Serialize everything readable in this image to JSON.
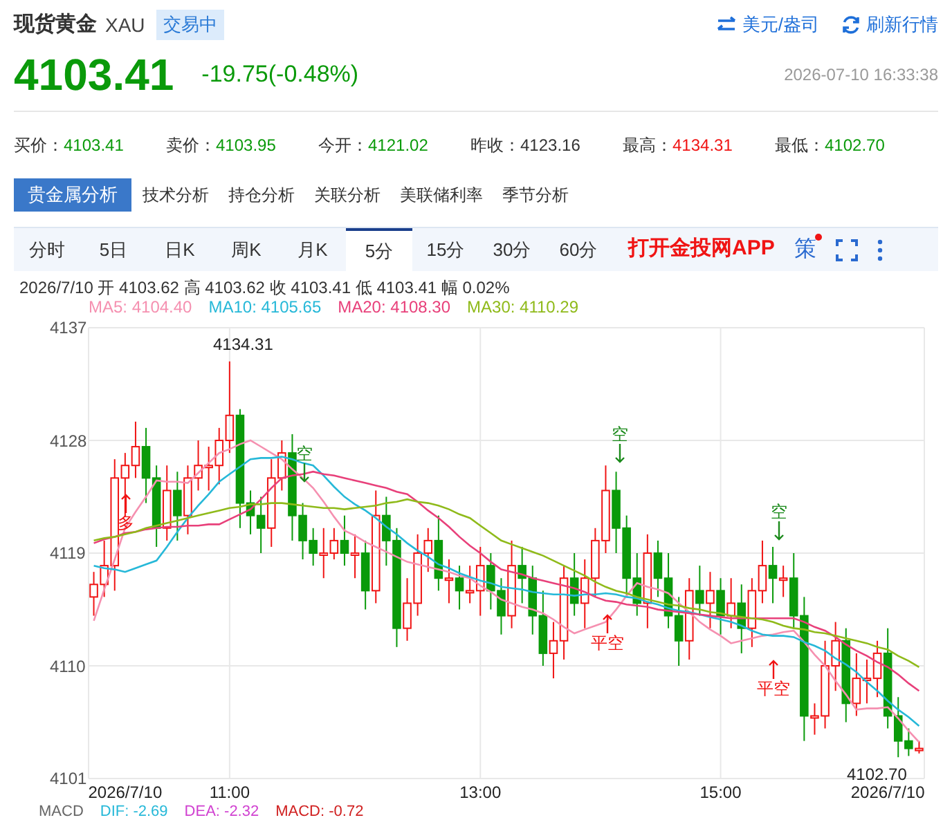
{
  "header": {
    "title": "现货黄金",
    "symbol": "XAU",
    "status": "交易中",
    "unit_link": "美元/盎司",
    "refresh_link": "刷新行情"
  },
  "quote": {
    "price": "4103.41",
    "change": "-19.75(-0.48%)",
    "time": "2026-07-10 16:33:38"
  },
  "stats": [
    {
      "label": "买价：",
      "value": "4103.41",
      "color": "#0a9a0a"
    },
    {
      "label": "卖价：",
      "value": "4103.95",
      "color": "#0a9a0a"
    },
    {
      "label": "今开：",
      "value": "4121.02",
      "color": "#0a9a0a"
    },
    {
      "label": "昨收：",
      "value": "4123.16",
      "color": "#333333"
    },
    {
      "label": "最高：",
      "value": "4134.31",
      "color": "#f01414"
    },
    {
      "label": "最低：",
      "value": "4102.70",
      "color": "#0a9a0a"
    }
  ],
  "analysis_tabs": [
    {
      "label": "贵金属分析",
      "selected": true
    },
    {
      "label": "技术分析",
      "selected": false
    },
    {
      "label": "持仓分析",
      "selected": false
    },
    {
      "label": "关联分析",
      "selected": false
    },
    {
      "label": "美联储利率",
      "selected": false
    },
    {
      "label": "季节分析",
      "selected": false
    }
  ],
  "periods": [
    {
      "label": "分时",
      "selected": false
    },
    {
      "label": "5日",
      "selected": false
    },
    {
      "label": "日K",
      "selected": false
    },
    {
      "label": "周K",
      "selected": false
    },
    {
      "label": "月K",
      "selected": false
    },
    {
      "label": "5分",
      "selected": true
    },
    {
      "label": "15分",
      "selected": false
    },
    {
      "label": "30分",
      "selected": false
    },
    {
      "label": "60分",
      "selected": false
    }
  ],
  "app_link": "打开金投网APP",
  "strategy": "策",
  "bar_info": "2026/7/10 开 4103.62 高 4103.62 收 4103.41 低 4103.41 幅 0.02%",
  "chart": {
    "chart_data": {
      "type": "candlestick",
      "grid": true,
      "ylim": [
        4101,
        4137
      ],
      "yticks": [
        4137,
        4128,
        4119,
        4110,
        4101
      ],
      "categories": [
        null,
        null,
        null,
        "2026/7/10",
        null,
        null,
        null,
        null,
        null,
        null,
        null,
        null,
        null,
        "11:00",
        null,
        null,
        null,
        null,
        null,
        null,
        null,
        null,
        null,
        null,
        null,
        null,
        null,
        null,
        null,
        null,
        null,
        null,
        null,
        null,
        null,
        null,
        null,
        "13:00",
        null,
        null,
        null,
        null,
        null,
        null,
        null,
        null,
        null,
        null,
        null,
        null,
        null,
        null,
        null,
        null,
        null,
        null,
        null,
        null,
        null,
        null,
        "15:00",
        null,
        null,
        null,
        null,
        null,
        null,
        null,
        null,
        null,
        null,
        null,
        null,
        null,
        null,
        null,
        "2026/7/10",
        null,
        null,
        null
      ],
      "ohlc": [
        [
          4115.5,
          4117.5,
          4114,
          4116.5
        ],
        [
          4116.5,
          4120,
          4115.5,
          4118
        ],
        [
          4118,
          4126.5,
          4116,
          4125
        ],
        [
          4125,
          4127,
          4122,
          4126
        ],
        [
          4126,
          4129.5,
          4125,
          4127.5
        ],
        [
          4127.5,
          4129,
          4123,
          4125
        ],
        [
          4125,
          4126,
          4119.5,
          4121
        ],
        [
          4121,
          4126,
          4120,
          4124
        ],
        [
          4124,
          4125.5,
          4120,
          4122
        ],
        [
          4122,
          4126,
          4120.5,
          4125
        ],
        [
          4125,
          4128,
          4124,
          4126
        ],
        [
          4126,
          4127.5,
          4124,
          4126
        ],
        [
          4126,
          4129,
          4124.5,
          4128
        ],
        [
          4128,
          4134.31,
          4127,
          4130
        ],
        [
          4130,
          4130.5,
          4121,
          4123
        ],
        [
          4123,
          4124,
          4120.5,
          4122
        ],
        [
          4122,
          4123.5,
          4119,
          4121
        ],
        [
          4121,
          4126.5,
          4119.5,
          4125
        ],
        [
          4125,
          4128,
          4124,
          4127
        ],
        [
          4127,
          4128.5,
          4120,
          4122
        ],
        [
          4122,
          4123,
          4118.5,
          4120
        ],
        [
          4120,
          4121,
          4118,
          4119
        ],
        [
          4119,
          4121,
          4117,
          4119
        ],
        [
          4119,
          4121,
          4118.5,
          4120
        ],
        [
          4120,
          4122,
          4118,
          4119
        ],
        [
          4119,
          4120.5,
          4117,
          4119
        ],
        [
          4119,
          4120,
          4114.5,
          4116
        ],
        [
          4116,
          4124,
          4115,
          4122
        ],
        [
          4122,
          4123.5,
          4118,
          4120
        ],
        [
          4120,
          4121,
          4111.5,
          4113
        ],
        [
          4113,
          4117,
          4112,
          4115
        ],
        [
          4115,
          4120.5,
          4114,
          4119
        ],
        [
          4119,
          4121,
          4117.5,
          4120
        ],
        [
          4120,
          4122,
          4116,
          4117
        ],
        [
          4117,
          4118.5,
          4115,
          4117
        ],
        [
          4117,
          4118,
          4114.5,
          4116
        ],
        [
          4116,
          4118,
          4115,
          4116
        ],
        [
          4116,
          4119.5,
          4114,
          4118
        ],
        [
          4118,
          4119,
          4114.5,
          4116
        ],
        [
          4116,
          4117,
          4112.5,
          4114
        ],
        [
          4114,
          4120,
          4113,
          4118
        ],
        [
          4118,
          4119.5,
          4115,
          4117
        ],
        [
          4117,
          4118,
          4112.5,
          4114
        ],
        [
          4114,
          4116,
          4110,
          4111
        ],
        [
          4111,
          4113.5,
          4109,
          4112
        ],
        [
          4112,
          4118,
          4110.5,
          4117
        ],
        [
          4117,
          4119,
          4114,
          4115
        ],
        [
          4115,
          4118.5,
          4113,
          4117
        ],
        [
          4117,
          4121,
          4115.5,
          4120
        ],
        [
          4120,
          4126,
          4119,
          4124
        ],
        [
          4124,
          4125.5,
          4119,
          4121
        ],
        [
          4121,
          4122,
          4115.5,
          4117
        ],
        [
          4117,
          4119,
          4114,
          4115
        ],
        [
          4115,
          4120.5,
          4113,
          4119
        ],
        [
          4119,
          4120,
          4115.5,
          4117
        ],
        [
          4117,
          4119,
          4113,
          4114
        ],
        [
          4114,
          4115.5,
          4110,
          4112
        ],
        [
          4112,
          4117,
          4110.5,
          4116
        ],
        [
          4116,
          4118,
          4114,
          4115
        ],
        [
          4115,
          4117.5,
          4113,
          4116
        ],
        [
          4116,
          4117,
          4112.5,
          4114
        ],
        [
          4114,
          4117,
          4113,
          4115
        ],
        [
          4115,
          4116.5,
          4111,
          4113
        ],
        [
          4113,
          4117,
          4111.5,
          4116
        ],
        [
          4116,
          4120,
          4115,
          4118
        ],
        [
          4118,
          4119.5,
          4115,
          4117
        ],
        [
          4117,
          4118,
          4115.5,
          4117
        ],
        [
          4117,
          4119,
          4113,
          4114
        ],
        [
          4114,
          4115.5,
          4104,
          4106
        ],
        [
          4106,
          4107,
          4104.5,
          4106
        ],
        [
          4106,
          4112,
          4105,
          4110
        ],
        [
          4110,
          4113.5,
          4108,
          4112
        ],
        [
          4112,
          4113,
          4105.5,
          4107
        ],
        [
          4107,
          4111,
          4106,
          4109
        ],
        [
          4109,
          4110.5,
          4107,
          4109
        ],
        [
          4109,
          4112,
          4107.5,
          4111
        ],
        [
          4111,
          4113,
          4105,
          4106
        ],
        [
          4106,
          4107.5,
          4102.7,
          4104
        ],
        [
          4104,
          4105,
          4102.8,
          4103.4
        ],
        [
          4103.4,
          4104,
          4103,
          4103.4
        ]
      ]
    },
    "ma_overlay": {
      "chart_data": {
        "type": "line",
        "ylim": [
          4101,
          4137
        ],
        "categories": [
          null,
          null,
          null,
          null,
          null,
          null,
          null,
          null,
          null,
          null,
          null,
          null,
          null,
          null,
          null,
          null,
          null,
          null,
          null,
          null,
          null,
          null,
          null,
          null,
          null,
          null,
          null,
          null,
          null,
          null,
          null,
          null,
          null,
          null,
          null,
          null,
          null,
          null,
          null,
          null,
          null,
          null,
          null,
          null,
          null,
          null,
          null,
          null,
          null,
          null,
          null,
          null,
          null,
          null,
          null,
          null,
          null,
          null,
          null,
          null,
          null,
          null,
          null,
          null,
          null,
          null,
          null,
          null,
          null,
          null,
          null,
          null,
          null,
          null,
          null,
          null,
          null,
          null,
          null,
          null
        ],
        "series": [
          {
            "name": "MA5: 4104.40",
            "color": "#f590b0",
            "values": [
              4113.6,
              4116.1,
              4118.5,
              4121,
              4122.3,
              4123.5,
              4124.8,
              4124.7,
              4124.7,
              4124.6,
              4125.4,
              4126.2,
              4127,
              4127.3,
              4127.7,
              4128,
              4127.5,
              4127,
              4126.5,
              4125.7,
              4125,
              4124.2,
              4123.1,
              4121.9,
              4120.8,
              4120.4,
              4119.9,
              4119.5,
              4119.1,
              4118.7,
              4118.3,
              4118.1,
              4117.9,
              4117.7,
              4117.5,
              4117.2,
              4117,
              4116.4,
              4115.9,
              4115.3,
              4115,
              4114.7,
              4114.5,
              4114.2,
              4113.7,
              4113.1,
              4112.6,
              4112.9,
              4113.2,
              4113.5,
              4114.5,
              4115.6,
              4116.6,
              4116.3,
              4116.1,
              4115.8,
              4115,
              4114.3,
              4113.5,
              4112.9,
              4112.4,
              4111.8,
              4112,
              4112.2,
              4112.4,
              4112.5,
              4112.7,
              4112.8,
              4111.9,
              4110.9,
              4110,
              4108.8,
              4107.7,
              4106.5,
              4106.6,
              4106.6,
              4106.7,
              4105.8,
              4104.8,
              4103.9
            ]
          },
          {
            "name": "MA10: 4105.65",
            "color": "#26b8d8",
            "values": [
              4118,
              4117.8,
              4117.7,
              4117.5,
              4117.8,
              4118.1,
              4118.4,
              4119.5,
              4120.7,
              4121.8,
              4122.8,
              4123.7,
              4124.7,
              4125.3,
              4125.9,
              4126.5,
              4126.6,
              4126.6,
              4126.7,
              4126.5,
              4126.2,
              4126,
              4125.2,
              4124.3,
              4123.5,
              4122.9,
              4122.4,
              4121.8,
              4121.1,
              4120.5,
              4119.8,
              4119.2,
              4118.7,
              4118.1,
              4117.8,
              4117.4,
              4117.1,
              4116.8,
              4116.6,
              4116.3,
              4116.2,
              4116.1,
              4115.9,
              4115.8,
              4115.7,
              4115.7,
              4115.6,
              4115.7,
              4115.7,
              4115.8,
              4115.7,
              4115.5,
              4115.4,
              4115.1,
              4114.9,
              4114.6,
              4114.4,
              4114.3,
              4114.1,
              4113.9,
              4113.7,
              4113.5,
              4113.2,
              4112.8,
              4112.5,
              4112.4,
              4112.4,
              4112.3,
              4111.9,
              4111.6,
              4111.2,
              4110.6,
              4110.1,
              4109.5,
              4108.7,
              4108,
              4107.2,
              4106.5,
              4105.9,
              4105.2
            ]
          },
          {
            "name": "MA20: 4108.30",
            "color": "#e8407a",
            "values": [
              4119.8,
              4120.1,
              4120.3,
              4120.6,
              4120.7,
              4120.9,
              4121,
              4121.1,
              4121.1,
              4121.2,
              4121.2,
              4121.3,
              4121.3,
              4121.7,
              4122.1,
              4122.5,
              4123.3,
              4124.2,
              4125,
              4125.2,
              4125.3,
              4125.5,
              4125.3,
              4125.2,
              4125,
              4124.8,
              4124.6,
              4124.4,
              4124.2,
              4123.9,
              4123.7,
              4123.1,
              4122.4,
              4121.8,
              4121.1,
              4120.3,
              4119.6,
              4119,
              4118.3,
              4117.7,
              4117.5,
              4117.3,
              4117,
              4116.8,
              4116.6,
              4116.4,
              4116.2,
              4115.9,
              4115.5,
              4115.2,
              4115.1,
              4114.9,
              4114.8,
              4114.7,
              4114.5,
              4114.4,
              4114.3,
              4114.2,
              4114.1,
              4114,
              4113.9,
              4113.8,
              4113.8,
              4113.8,
              4113.8,
              4113.8,
              4113.8,
              4113.8,
              4113.5,
              4113.1,
              4112.8,
              4112.3,
              4111.7,
              4111.2,
              4110.8,
              4110.3,
              4109.9,
              4109.3,
              4108.6,
              4108
            ]
          },
          {
            "name": "MA30: 4110.29",
            "color": "#8fba1a",
            "values": [
              4120,
              4120.2,
              4120.3,
              4120.5,
              4120.7,
              4121,
              4121.2,
              4121.4,
              4121.6,
              4121.8,
              4122,
              4122.2,
              4122.4,
              4122.6,
              4122.7,
              4122.9,
              4122.9,
              4123,
              4123,
              4122.9,
              4122.8,
              4122.7,
              4122.6,
              4122.6,
              4122.5,
              4122.6,
              4122.7,
              4122.8,
              4123,
              4123.1,
              4123.3,
              4123.1,
              4123,
              4122.8,
              4122.5,
              4122.1,
              4121.8,
              4121.2,
              4120.6,
              4120,
              4119.7,
              4119.4,
              4119.1,
              4118.8,
              4118.4,
              4118,
              4117.6,
              4117.2,
              4116.7,
              4116.3,
              4116,
              4115.8,
              4115.5,
              4115.3,
              4115.1,
              4114.9,
              4114.8,
              4114.6,
              4114.5,
              4114.3,
              4114.2,
              4114,
              4113.9,
              4113.8,
              4113.7,
              4113.5,
              4113.2,
              4113,
              4112.9,
              4112.7,
              4112.6,
              4112.4,
              4112.2,
              4112,
              4111.8,
              4111.5,
              4111.3,
              4110.8,
              4110.4,
              4109.9
            ]
          }
        ]
      }
    },
    "high_label": "4134.31",
    "low_label": "4102.70",
    "signals": [
      {
        "text": "空",
        "kind": "short"
      },
      {
        "text": "多",
        "kind": "long"
      },
      {
        "text": "空",
        "kind": "short"
      },
      {
        "text": "平空",
        "kind": "cover"
      },
      {
        "text": "空",
        "kind": "short"
      },
      {
        "text": "平空",
        "kind": "cover"
      }
    ]
  },
  "macd": [
    {
      "label": "MACD",
      "color": "#666666"
    },
    {
      "label": "DIF: -2.69",
      "color": "#26b8d8"
    },
    {
      "label": "DEA: -2.32",
      "color": "#d040d0"
    },
    {
      "label": "MACD: -0.72",
      "color": "#d02020"
    }
  ]
}
